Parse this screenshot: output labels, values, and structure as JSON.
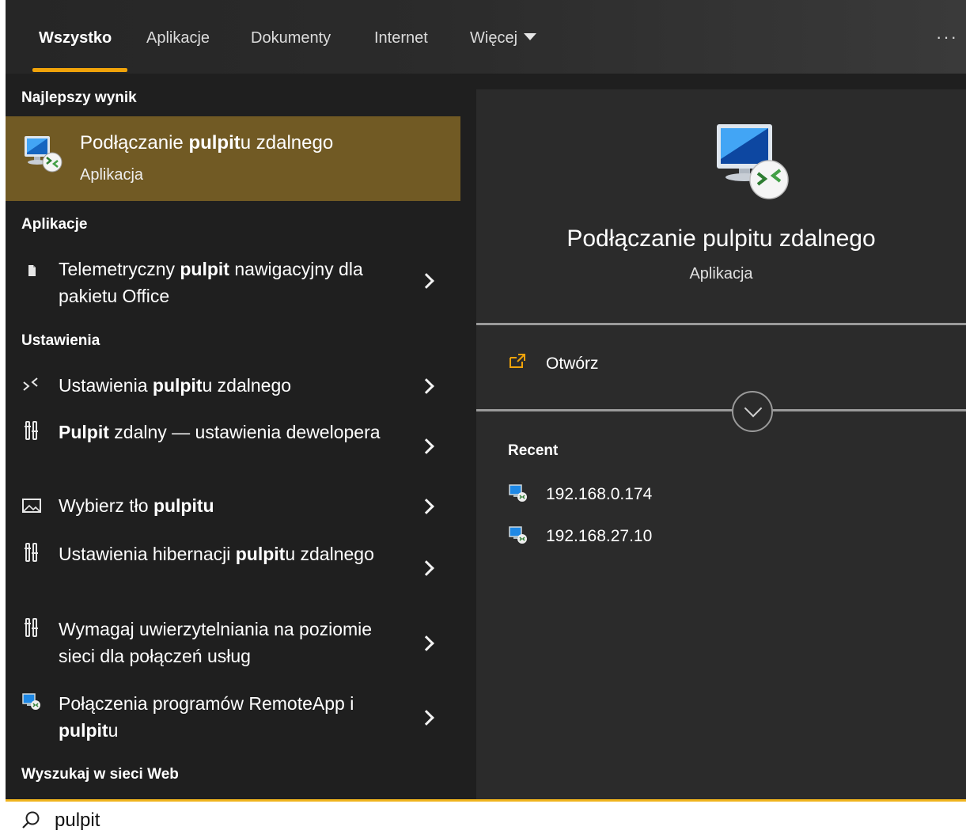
{
  "tabs": [
    {
      "label": "Wszystko",
      "active": true
    },
    {
      "label": "Aplikacje",
      "active": false
    },
    {
      "label": "Dokumenty",
      "active": false
    },
    {
      "label": "Internet",
      "active": false
    },
    {
      "label": "Więcej",
      "active": false
    }
  ],
  "more_dots": "···",
  "sections": {
    "best": "Najlepszy wynik",
    "apps": "Aplikacje",
    "settings": "Ustawienia",
    "web": "Wyszukaj w sieci Web"
  },
  "best_result": {
    "title_pre": "Podłączanie ",
    "title_bold": "pulpit",
    "title_post": "u zdalnego",
    "subtitle": "Aplikacja",
    "icon": "remote-desktop-icon"
  },
  "app_items": [
    {
      "pre": "Telemetryczny ",
      "bold": "pulpit",
      "post": " nawigacyjny dla pakietu Office",
      "icon": "document-icon"
    }
  ],
  "settings_items": [
    {
      "pre": "Ustawienia ",
      "bold": "pulpit",
      "post": "u zdalnego",
      "icon": "remote-arrows-icon"
    },
    {
      "pre": "",
      "bold": "Pulpit",
      "post": " zdalny — ustawienia dewelopera",
      "icon": "developer-tools-icon"
    },
    {
      "pre": "Wybierz tło ",
      "bold": "pulpitu",
      "post": "",
      "icon": "picture-icon"
    },
    {
      "pre": "Ustawienia hibernacji ",
      "bold": "pulpit",
      "post": "u zdalnego",
      "icon": "developer-tools-icon"
    },
    {
      "pre": "Wymagaj uwierzytelniania na poziomie sieci dla połączeń usług",
      "bold": "",
      "post": "",
      "icon": "developer-tools-icon"
    },
    {
      "pre": "Połączenia programów RemoteApp i ",
      "bold": "pulpit",
      "post": "u",
      "icon": "remoteapp-icon"
    }
  ],
  "details": {
    "title": "Podłączanie pulpitu zdalnego",
    "subtitle": "Aplikacja",
    "open_label": "Otwórz",
    "recent_header": "Recent",
    "recent": [
      "192.168.0.174",
      "192.168.27.10"
    ]
  },
  "search": {
    "value": "pulpit"
  },
  "colors": {
    "accent": "#f0a30a",
    "best_highlight": "#715a24",
    "panel": "#1f1f1f",
    "details_panel": "#2b2b2b"
  }
}
